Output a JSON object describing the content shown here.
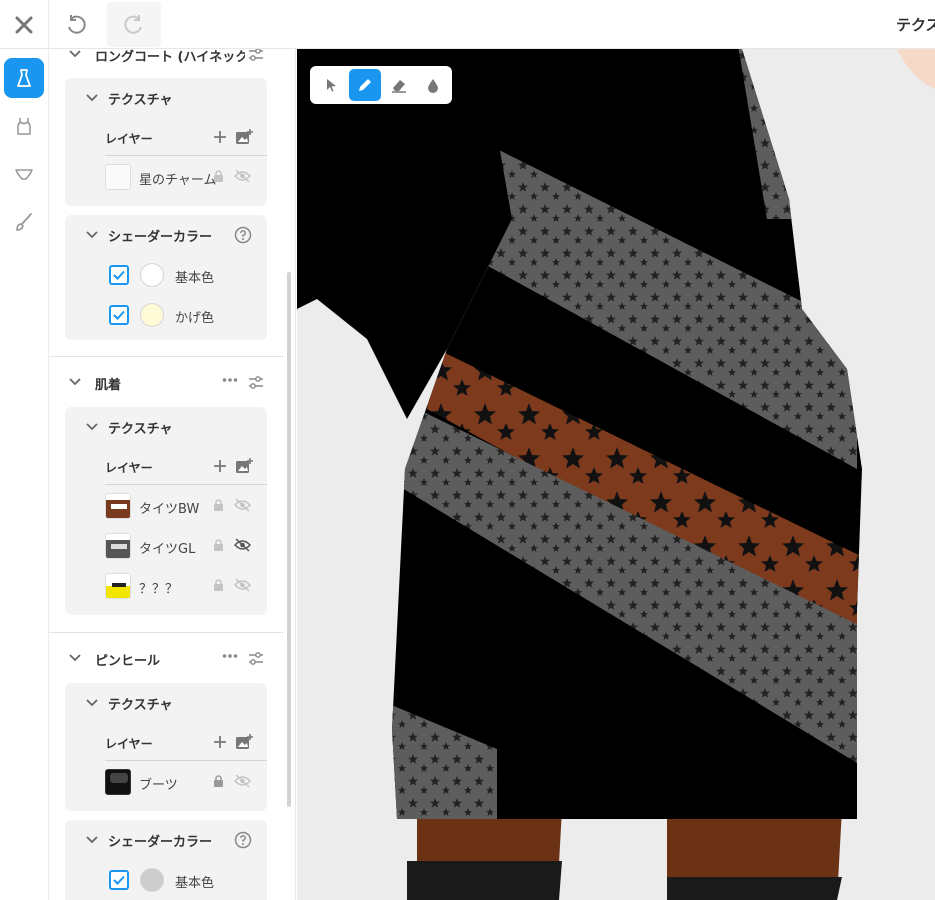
{
  "header": {
    "title": "テクスチャ"
  },
  "sections": [
    {
      "name": "ロングコート (ハイネック)",
      "texture": {
        "label": "テクスチャ",
        "layers_label": "レイヤー",
        "layers": [
          {
            "name": "星のチャーム"
          }
        ]
      },
      "shader": {
        "label": "シェーダーカラー",
        "colors": [
          {
            "name": "基本色",
            "value": "#ffffff"
          },
          {
            "name": "かげ色",
            "value": "#fffbd6"
          }
        ]
      }
    },
    {
      "name": "肌着",
      "texture": {
        "label": "テクスチャ",
        "layers_label": "レイヤー",
        "layers": [
          {
            "name": "タイツBW"
          },
          {
            "name": "タイツGL"
          },
          {
            "name": "？？？"
          }
        ]
      }
    },
    {
      "name": "ピンヒール",
      "texture": {
        "label": "テクスチャ",
        "layers_label": "レイヤー",
        "layers": [
          {
            "name": "ブーツ"
          }
        ]
      },
      "shader": {
        "label": "シェーダーカラー",
        "colors": [
          {
            "name": "基本色",
            "value": "#cccccc"
          }
        ]
      }
    }
  ],
  "colors": {
    "accent": "#1a96f0"
  }
}
